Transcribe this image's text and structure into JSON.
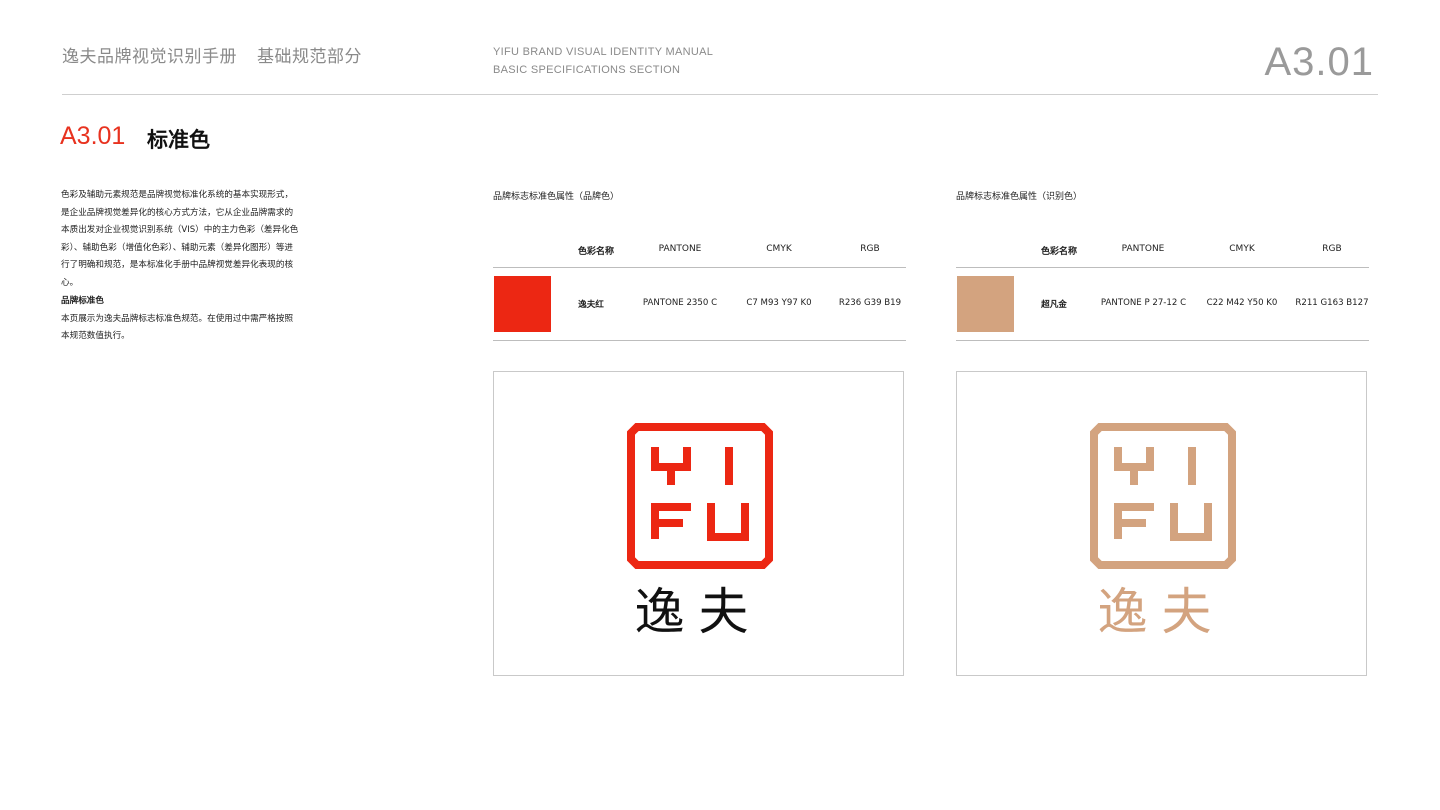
{
  "header": {
    "cn_title": "逸夫品牌视觉识别手册",
    "cn_section": "基础规范部分",
    "en_line1": "YIFU BRAND VISUAL IDENTITY MANUAL",
    "en_line2": "BASIC SPECIFICATIONS SECTION",
    "page_code": "A3.01"
  },
  "section": {
    "code": "A3.01",
    "title": "标准色"
  },
  "description": {
    "paragraph": "色彩及辅助元素规范是品牌视觉标准化系统的基本实现形式，是企业品牌视觉差异化的核心方式方法，它从企业品牌需求的本质出发对企业视觉识别系统（VIS）中的主力色彩（差异化色彩）、辅助色彩（增值化色彩）、辅助元素（差异化图形）等进行了明确和规范，是本标准化手册中品牌视觉差异化表现的核心。",
    "subheading": "品牌标准色",
    "note": "本页展示为逸夫品牌标志标准色规范。在使用过中需严格按照本规范数值执行。"
  },
  "table_headers": {
    "name": "色彩名称",
    "pantone": "PANTONE",
    "cmyk": "CMYK",
    "rgb": "RGB"
  },
  "panels": [
    {
      "title": "品牌标志标准色属性（品牌色）",
      "color_name": "逸夫红",
      "pantone": "PANTONE 2350 C",
      "cmyk": "C7 M93 Y97 K0",
      "rgb": "R236 G39 B19",
      "hex": "#ec2713",
      "logo_letters": [
        "Y",
        "I",
        "F",
        "U"
      ],
      "logo_cn": "逸夫",
      "logo_cn_color": "#111111"
    },
    {
      "title": "品牌标志标准色属性（识别色）",
      "color_name": "超凡金",
      "pantone": "PANTONE P 27-12 C",
      "cmyk": "C22 M42 Y50 K0",
      "rgb": "R211 G163 B127",
      "hex": "#d3a37f",
      "logo_letters": [
        "Y",
        "I",
        "F",
        "U"
      ],
      "logo_cn": "逸夫",
      "logo_cn_color": "#d3a37f"
    }
  ]
}
